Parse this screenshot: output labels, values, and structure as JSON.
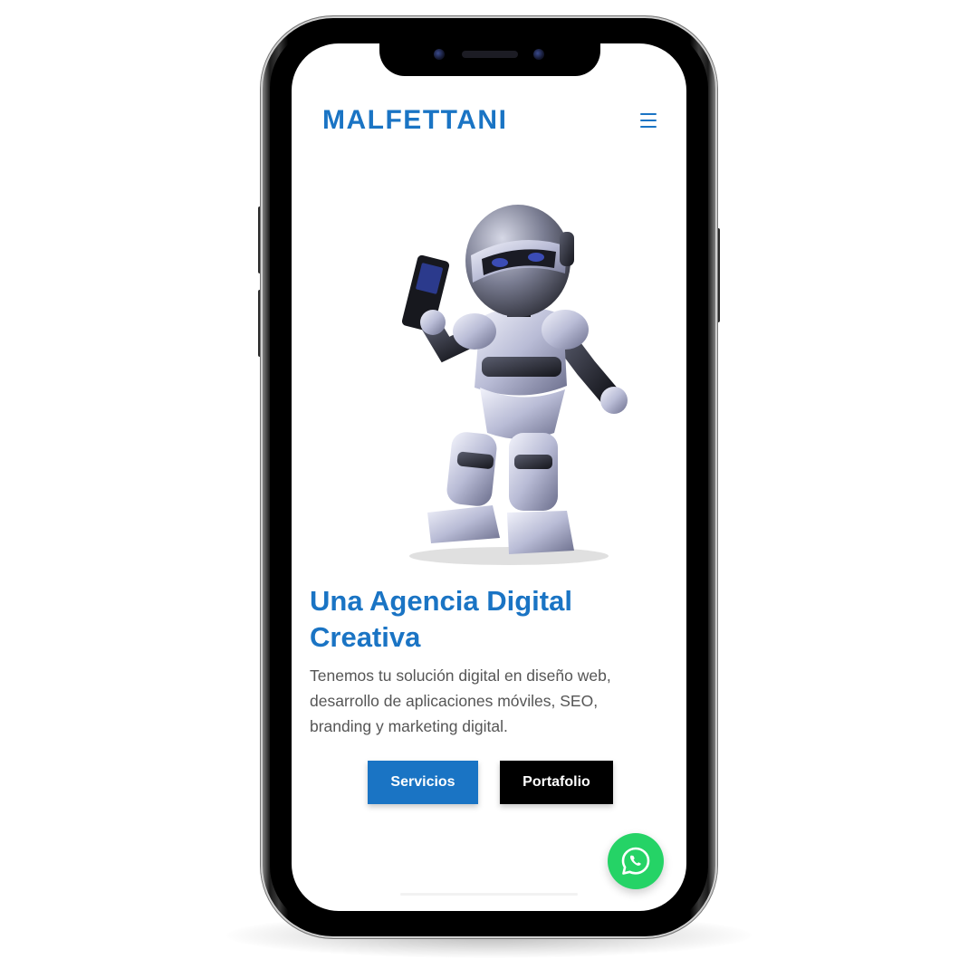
{
  "device": "smartphone-mockup",
  "header": {
    "logo_text": "MALFETTANI",
    "menu_icon": "hamburger-menu-icon"
  },
  "hero": {
    "image_description": "robot-holding-mobile-phone",
    "title": "Una Agencia Digital Creativa",
    "description": "Tenemos tu solución digital en diseño web, desarrollo de aplicaciones móviles, SEO, branding y marketing digital."
  },
  "actions": {
    "services_label": "Servicios",
    "portfolio_label": "Portafolio"
  },
  "floating": {
    "whatsapp_icon": "whatsapp-icon"
  },
  "colors": {
    "brand_blue": "#1a74c4",
    "whatsapp_green": "#25d366",
    "portfolio_button": "#000000",
    "body_text": "#555555"
  }
}
